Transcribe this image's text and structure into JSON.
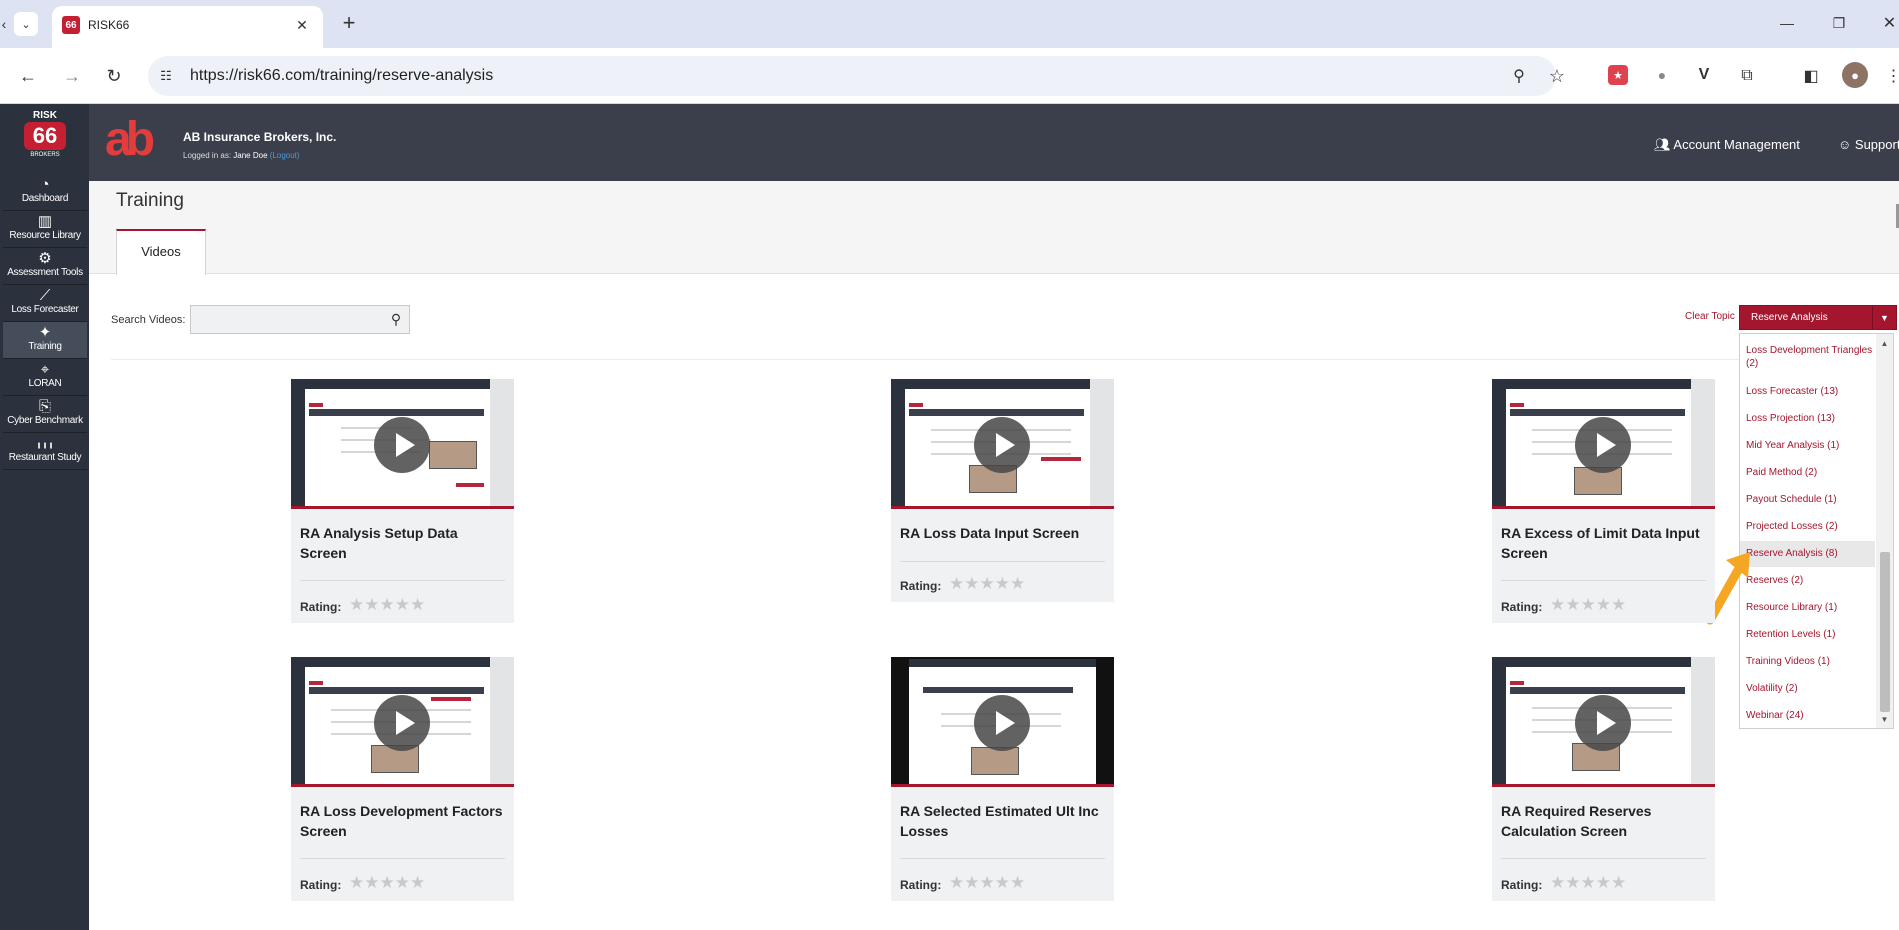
{
  "browser": {
    "tab_title": "RISK66",
    "favicon_text": "66",
    "url": "https://risk66.com/training/reserve-analysis",
    "new_tab": "+",
    "close_tab": "✕"
  },
  "app": {
    "logo_top": "RISK",
    "logo_num": "66",
    "logo_bottom": "BROKERS",
    "company": "AB Insurance Brokers, Inc.",
    "logged_in_label": "Logged in as:",
    "user": "Jane Doe",
    "logout": "(Logout)",
    "brand_mark": "ab",
    "account_management": "Account Management",
    "support": "Support",
    "accent_color": "#a3162e"
  },
  "sidebar": {
    "items": [
      {
        "label": "Dashboard",
        "icon": "dashboard-icon",
        "glyph": "◔"
      },
      {
        "label": "Resource Library",
        "icon": "library-icon",
        "glyph": "▥"
      },
      {
        "label": "Assessment Tools",
        "icon": "gears-icon",
        "glyph": "⚙"
      },
      {
        "label": "Loss Forecaster",
        "icon": "line-chart-icon",
        "glyph": "⟋"
      },
      {
        "label": "Training",
        "icon": "training-icon",
        "glyph": "✦"
      },
      {
        "label": "LORAN",
        "icon": "location-pin-icon",
        "glyph": "⌖"
      },
      {
        "label": "Cyber Benchmark",
        "icon": "cyber-icon",
        "glyph": "⎘"
      },
      {
        "label": "Restaurant Study",
        "icon": "bar-chart-icon",
        "glyph": "╻╻╻"
      }
    ]
  },
  "page": {
    "title": "Training",
    "tab_videos": "Videos",
    "search_label": "Search Videos:",
    "search_placeholder": "",
    "clear_topic": "Clear Topic",
    "selected_topic": "Reserve Analysis"
  },
  "videos": [
    {
      "title": "RA Analysis Setup Data Screen",
      "rating_label": "Rating:",
      "stars": "★★★★★"
    },
    {
      "title": "RA Loss Data Input Screen",
      "rating_label": "Rating:",
      "stars": "★★★★★"
    },
    {
      "title": "RA Excess of Limit Data Input Screen",
      "rating_label": "Rating:",
      "stars": "★★★★★"
    },
    {
      "title": "RA Loss Development Factors Screen",
      "rating_label": "Rating:",
      "stars": "★★★★★"
    },
    {
      "title": "RA Selected Estimated Ult Inc Losses",
      "rating_label": "Rating:",
      "stars": "★★★★★"
    },
    {
      "title": "RA Required Reserves Calculation Screen",
      "rating_label": "Rating:",
      "stars": "★★★★★"
    }
  ],
  "topic_options": [
    "Loss Development Triangles (2)",
    "Loss Forecaster (13)",
    "Loss Projection (13)",
    "Mid Year Analysis (1)",
    "Paid Method (2)",
    "Payout Schedule (1)",
    "Projected Losses (2)",
    "Reserve Analysis (8)",
    "Reserves (2)",
    "Resource Library (1)",
    "Retention Levels (1)",
    "Training Videos (1)",
    "Volatility (2)",
    "Webinar (24)"
  ]
}
